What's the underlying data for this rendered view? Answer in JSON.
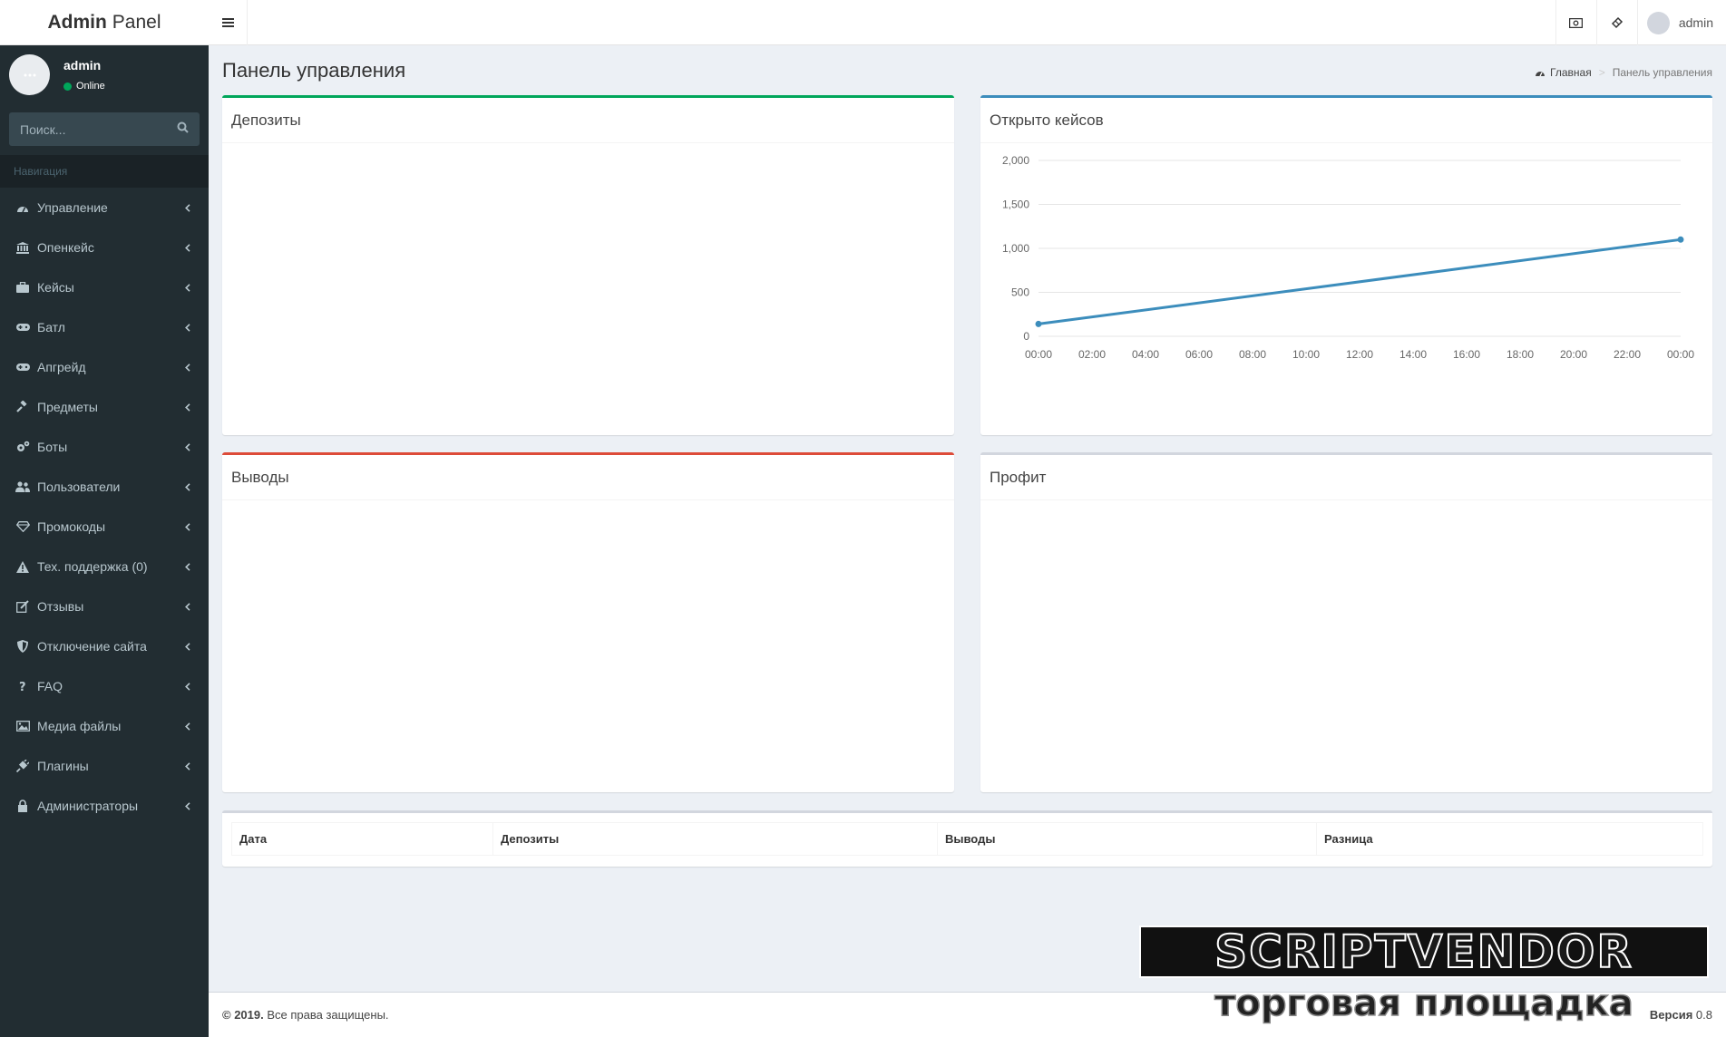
{
  "brand": {
    "bold": "Admin",
    "rest": "Panel"
  },
  "user": {
    "name": "admin",
    "status": "Online"
  },
  "search": {
    "placeholder": "Поиск..."
  },
  "nav": {
    "header": "Навигация",
    "items": [
      {
        "label": "Управление",
        "icon": "dashboard-icon"
      },
      {
        "label": "Опенкейс",
        "icon": "bank-icon"
      },
      {
        "label": "Кейсы",
        "icon": "briefcase-icon"
      },
      {
        "label": "Батл",
        "icon": "gamepad-icon"
      },
      {
        "label": "Апгрейд",
        "icon": "gamepad-icon"
      },
      {
        "label": "Предметы",
        "icon": "gavel-icon"
      },
      {
        "label": "Боты",
        "icon": "cogs-icon"
      },
      {
        "label": "Пользователи",
        "icon": "users-icon"
      },
      {
        "label": "Промокоды",
        "icon": "diamond-icon"
      },
      {
        "label": "Тех. поддержка (0)",
        "icon": "warning-icon"
      },
      {
        "label": "Отзывы",
        "icon": "edit-icon"
      },
      {
        "label": "Отключение сайта",
        "icon": "shield-icon"
      },
      {
        "label": "FAQ",
        "icon": "question-icon"
      },
      {
        "label": "Медиа файлы",
        "icon": "image-icon"
      },
      {
        "label": "Плагины",
        "icon": "plug-icon"
      },
      {
        "label": "Администраторы",
        "icon": "lock-icon"
      }
    ]
  },
  "topbar": {
    "user_name": "admin"
  },
  "page": {
    "title": "Панель управления",
    "breadcrumb_home": "Главная",
    "breadcrumb_current": "Панель управления"
  },
  "boxes": {
    "deposits": "Депозиты",
    "opened_cases": "Открыто кейсов",
    "withdrawals": "Выводы",
    "profit": "Профит"
  },
  "chart_data": {
    "type": "line",
    "x": [
      "00:00",
      "02:00",
      "04:00",
      "06:00",
      "08:00",
      "10:00",
      "12:00",
      "14:00",
      "16:00",
      "18:00",
      "20:00",
      "22:00",
      "00:00"
    ],
    "series": [
      {
        "points": [
          [
            0,
            140
          ],
          [
            12,
            1100
          ]
        ],
        "color": "#3c8dbc"
      }
    ],
    "ylim": [
      0,
      2000
    ],
    "yticks": [
      0,
      500,
      1000,
      1500,
      2000
    ],
    "ytick_labels": [
      "0",
      "500",
      "1,000",
      "1,500",
      "2,000"
    ],
    "grid": true
  },
  "table": {
    "headers": [
      "Дата",
      "Депозиты",
      "Выводы",
      "Разница"
    ]
  },
  "footer": {
    "copyright": "© 2019.",
    "rights": "Все права защищены.",
    "version_label": "Версия",
    "version": "0.8"
  },
  "watermark": {
    "line1": "SCRIPTVENDOR",
    "line2": "торговая площадка"
  },
  "colors": {
    "sidebar": "#222d32",
    "accent": "#3c8dbc",
    "success": "#00a65a",
    "danger": "#dd4b39"
  }
}
